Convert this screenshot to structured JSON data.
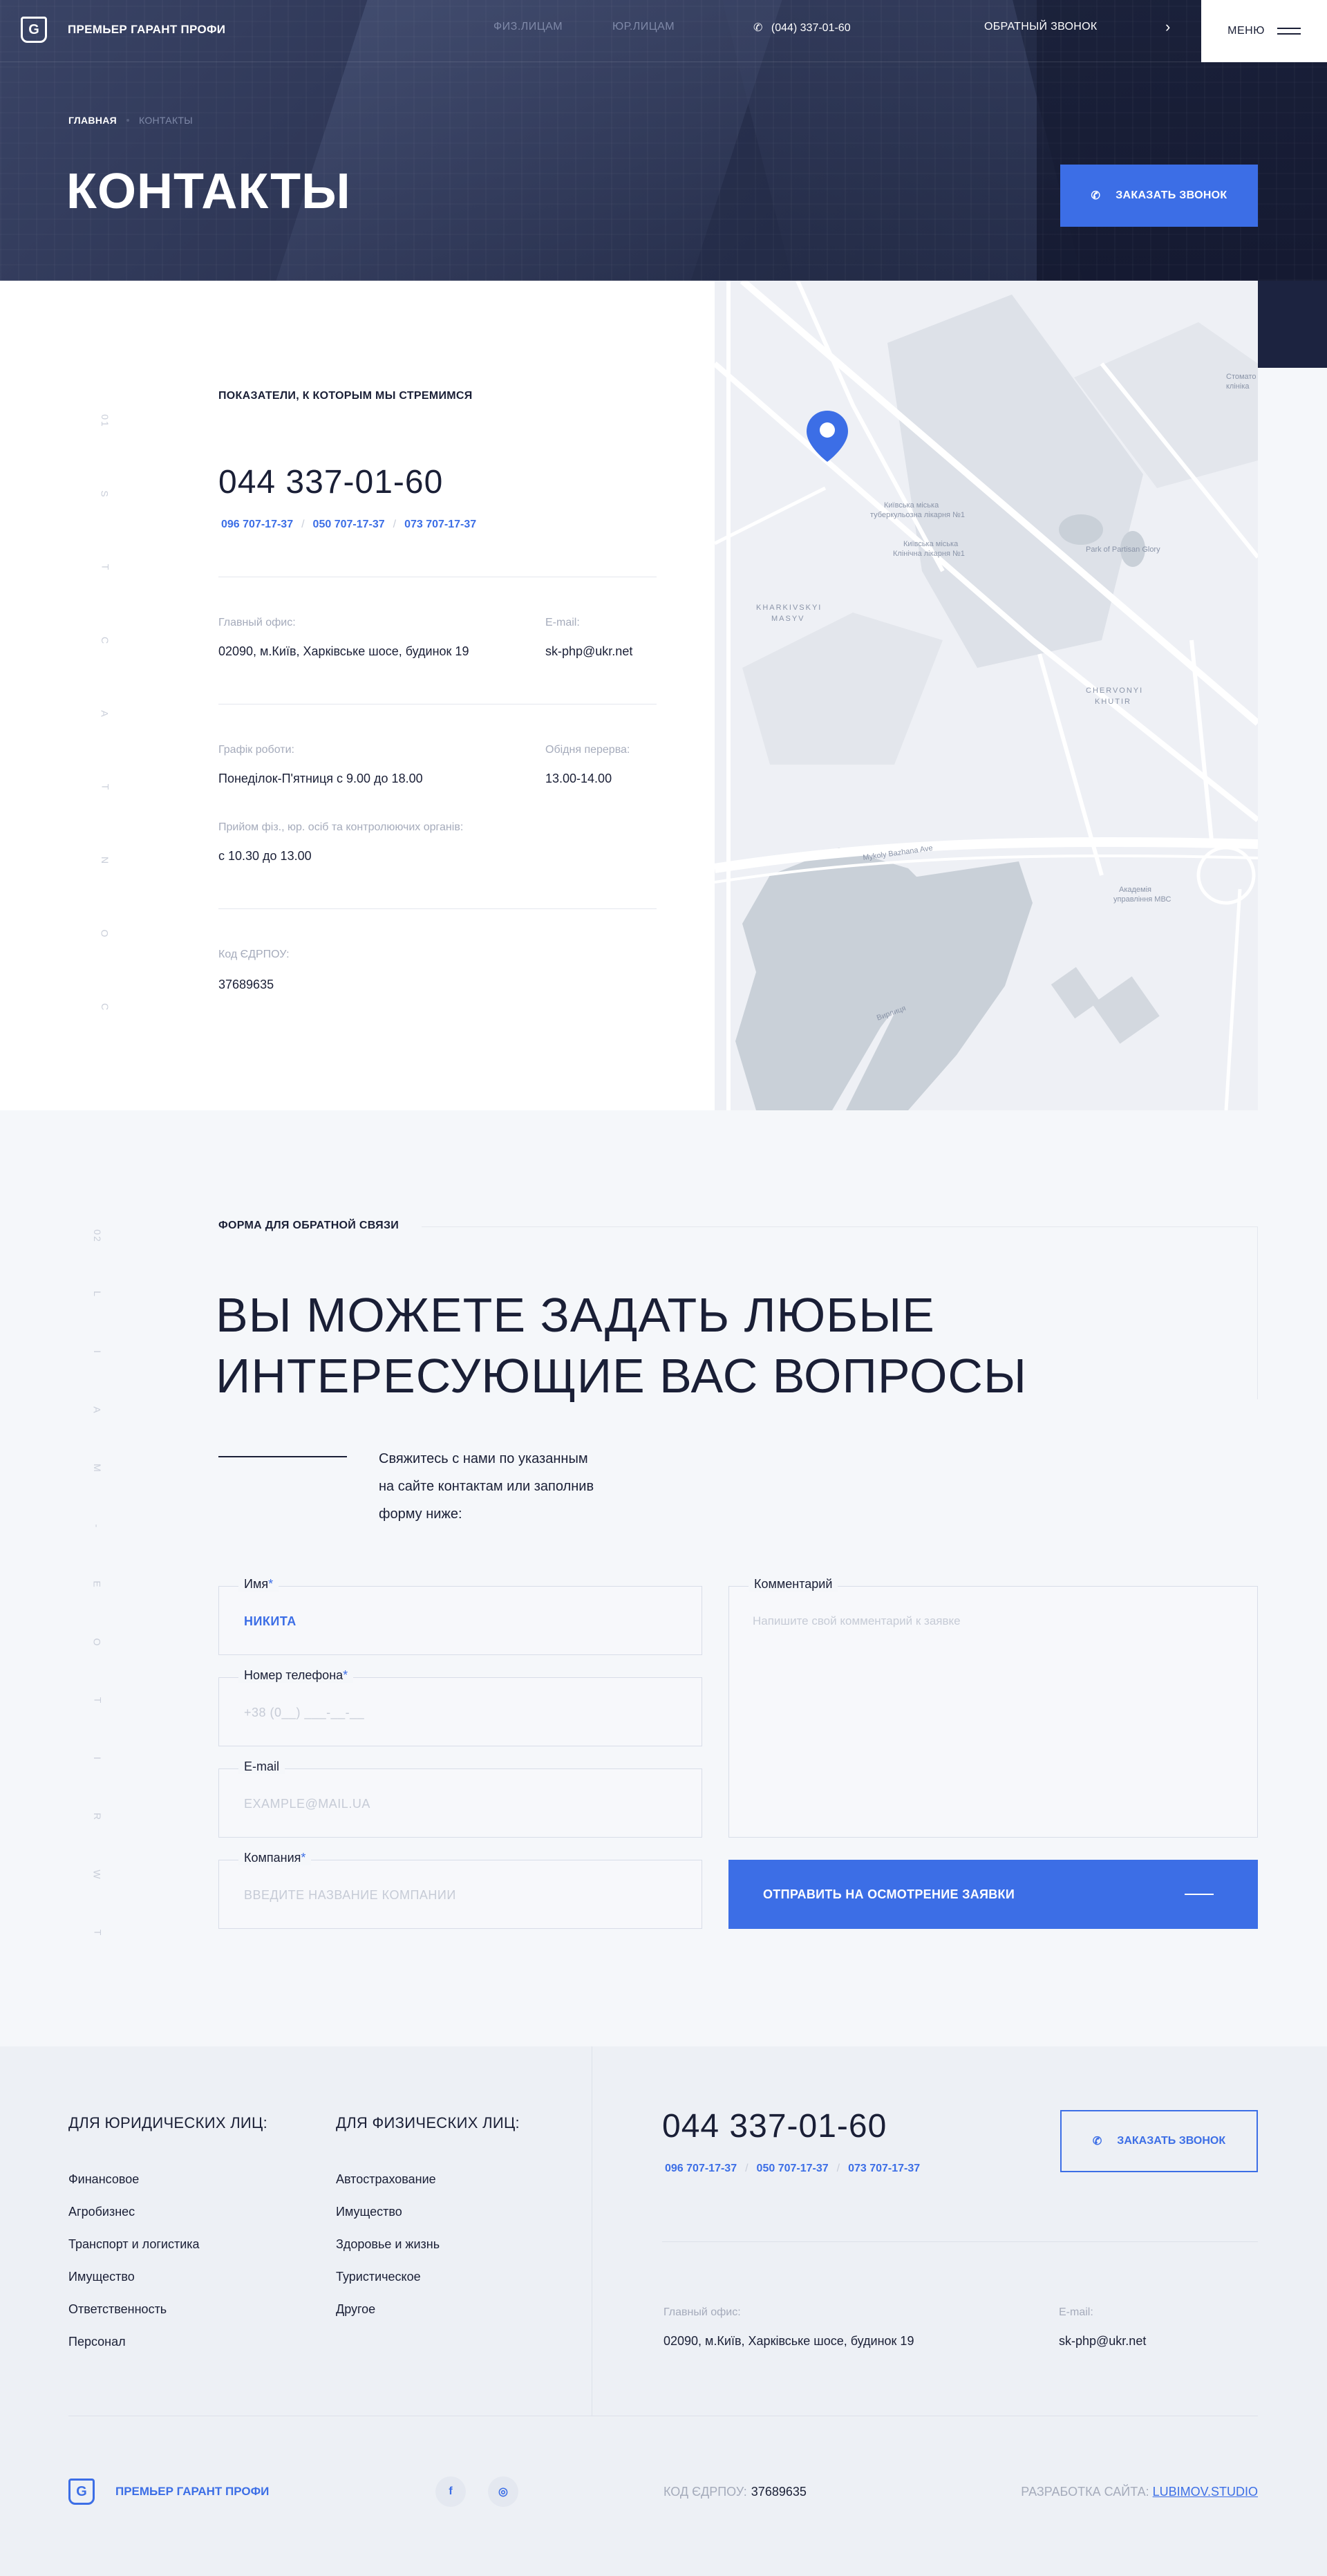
{
  "header": {
    "brand": "ПРЕМЬЕР ГАРАНТ ПРОФИ",
    "logo_letter": "G",
    "nav": [
      "ФИЗ.ЛИЦАМ",
      "ЮР.ЛИЦАМ"
    ],
    "phone": "(044) 337-01-60",
    "callback": "ОБРАТНЫЙ ЗВОНОК",
    "menu": "МЕНЮ"
  },
  "hero": {
    "breadcrumb_home": "ГЛАВНАЯ",
    "breadcrumb_current": "КОНТАКТЫ",
    "title": "КОНТАКТЫ",
    "order_button": "ЗАКАЗАТЬ ЗВОНОК"
  },
  "contacts": {
    "side_letters": [
      "01",
      "S",
      "T",
      "C",
      "A",
      "T",
      "N",
      "O",
      "C"
    ],
    "section_label": "ПОКАЗАТЕЛИ, К КОТОРЫМ МЫ СТРЕМИМСЯ",
    "main_phone": "044 337-01-60",
    "mobile_phones": [
      "096 707-17-37",
      "050 707-17-37",
      "073 707-17-37"
    ],
    "office_label": "Главный офис:",
    "office_value": "02090, м.Київ, Харківське шосе, будинок 19",
    "email_label": "E-mail:",
    "email_value": "sk-php@ukr.net",
    "schedule_label": "Графік роботи:",
    "schedule_value": "Понеділок-П'ятниця с 9.00 до 18.00",
    "lunch_label": "Обідня перерва:",
    "lunch_value": "13.00-14.00",
    "reception_label": "Прийом фіз., юр. осіб та контролюючих органів:",
    "reception_value": "с 10.30 до 13.00",
    "edrpou_label": "Код ЄДРПОУ:",
    "edrpou_value": "37689635"
  },
  "map": {
    "labels": [
      "Київська міська туберкульозна лікарня №1",
      "Київська міська Клінічна лікарня №1",
      "KHARKIVSKYI MASYV",
      "Park of Partisan Glory",
      "CHERVONYI KHUTIR",
      "Mykoly Bazhana Ave",
      "Академія управління МВС",
      "Вирлиця",
      "Стомато клініка"
    ]
  },
  "feedback": {
    "side_letters": [
      "02",
      "L",
      "I",
      "A",
      "M",
      "-",
      "E",
      "O",
      "T",
      "I",
      "R",
      "W",
      "T"
    ],
    "section_label": "ФОРМА ДЛЯ ОБРАТНОЙ СВЯЗИ",
    "heading_line1": "ВЫ МОЖЕТЕ ЗАДАТЬ ЛЮБЫЕ",
    "heading_line2": "ИНТЕРЕСУЮЩИЕ ВАС ВОПРОСЫ",
    "intro_line1": "Свяжитесь с нами по указанным",
    "intro_line2": "на сайте контактам или заполнив",
    "intro_line3": "форму ниже:",
    "name_label": "Имя",
    "name_value": "НИКИТА",
    "phone_label": "Номер телефона",
    "phone_placeholder": "+38 (0__) ___-__-__",
    "email_label": "E-mail",
    "email_placeholder": "EXAMPLE@MAIL.UA",
    "company_label": "Компания",
    "company_placeholder": "ВВЕДИТЕ НАЗВАНИЕ КОМПАНИИ",
    "comment_label": "Комментарий",
    "comment_placeholder": "Напишите свой комментарий к заявке",
    "required_mark": "*",
    "submit": "ОТПРАВИТЬ НА ОСМОТРЕНИЕ ЗАЯВКИ"
  },
  "footer": {
    "legal_title": "ДЛЯ ЮРИДИЧЕСКИХ ЛИЦ:",
    "legal_items": [
      "Финансовое",
      "Агробизнес",
      "Транспорт и логистика",
      "Имущество",
      "Ответственность",
      "Персонал"
    ],
    "personal_title": "ДЛЯ ФИЗИЧЕСКИХ ЛИЦ:",
    "personal_items": [
      "Автострахование",
      "Имущество",
      "Здоровье и жизнь",
      "Туристическое",
      "Другое"
    ],
    "phone": "044 337-01-60",
    "mobile_phones": [
      "096 707-17-37",
      "050 707-17-37",
      "073 707-17-37"
    ],
    "order_button": "ЗАКАЗАТЬ ЗВОНОК",
    "office_label": "Главный офис:",
    "office_value": "02090, м.Київ, Харківське шосе, будинок 19",
    "email_label": "E-mail:",
    "email_value": "sk-php@ukr.net",
    "brand": "ПРЕМЬЕР ГАРАНТ ПРОФИ",
    "social": [
      "f",
      "◎"
    ],
    "edrpou_label": "КОД ЄДРПОУ:",
    "edrpou_value": "37689635",
    "dev_label": "РАЗРАБОТКА САЙТА:",
    "dev_link": "LUBIMOV.STUDIO"
  },
  "colors": {
    "accent": "#3c6ee6",
    "dark": "#1a1f36",
    "hero": "#2a3250"
  }
}
